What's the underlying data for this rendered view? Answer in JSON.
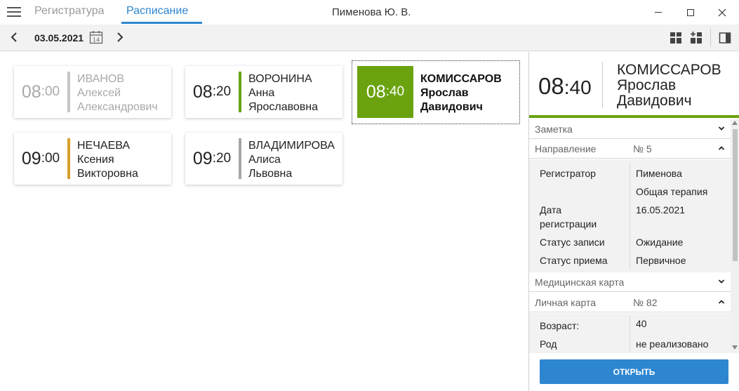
{
  "window": {
    "user": "Пименова Ю. В."
  },
  "tabs": {
    "registry": "Регистратура",
    "schedule": "Расписание"
  },
  "toolbar": {
    "date": "03.05.2021",
    "calendar_day": "14"
  },
  "appointments": [
    {
      "hh": "08",
      "mm": ":00",
      "surname": "ИВАНОВ",
      "first_name": "Алексей",
      "patronymic": "Александрович",
      "status": "past",
      "bar_color": "#c6c6c6"
    },
    {
      "hh": "08",
      "mm": ":20",
      "surname": "ВОРОНИНА",
      "first_name": "Анна",
      "patronymic": "Ярославовна",
      "status": "upcoming",
      "bar_color": "#6aa30f"
    },
    {
      "hh": "08",
      "mm": ":40",
      "surname": "КОМИССАРОВ",
      "first_name": "Ярослав",
      "patronymic": "Давидович",
      "status": "selected",
      "bar_color": "#6aa30f"
    },
    {
      "hh": "09",
      "mm": ":00",
      "surname": "НЕЧАЕВА",
      "first_name": "Ксения",
      "patronymic": "Викторовна",
      "status": "upcoming",
      "bar_color": "#d6a02a"
    },
    {
      "hh": "09",
      "mm": ":20",
      "surname": "ВЛАДИМИРОВА",
      "first_name": "Алиса",
      "patronymic": "Львовна",
      "status": "upcoming",
      "bar_color": "#a6a6a6"
    }
  ],
  "details": {
    "hh": "08",
    "mm": ":40",
    "surname": "КОМИССАРОВ",
    "first_name": "Ярослав",
    "patronymic": "Давидович",
    "sections": {
      "note": {
        "title": "Заметка"
      },
      "referral": {
        "title": "Направление",
        "value": "№ 5",
        "rows": {
          "registrar_label": "Регистратор",
          "registrar_value": "Пименова",
          "department_value": "Общая терапия",
          "reg_date_label_1": "Дата",
          "reg_date_label_2": "регистрации",
          "reg_date_value": "16.05.2021",
          "record_status_label": "Статус записи",
          "record_status_value": "Ожидание",
          "visit_status_label": "Статус приема",
          "visit_status_value": "Первичное"
        }
      },
      "medical_card": {
        "title": "Медицинская карта"
      },
      "personal_card": {
        "title": "Личная карта",
        "value": "№ 82",
        "rows": {
          "age_label": "Возраст:",
          "age_value": "40",
          "gender_label": "Род",
          "gender_value": "не реализовано"
        }
      }
    },
    "open_button": "ОТКРЫТЬ"
  },
  "colors": {
    "accent": "#2e86d1",
    "green": "#6aa30f",
    "orange": "#d6a02a",
    "gray": "#a6a6a6"
  }
}
